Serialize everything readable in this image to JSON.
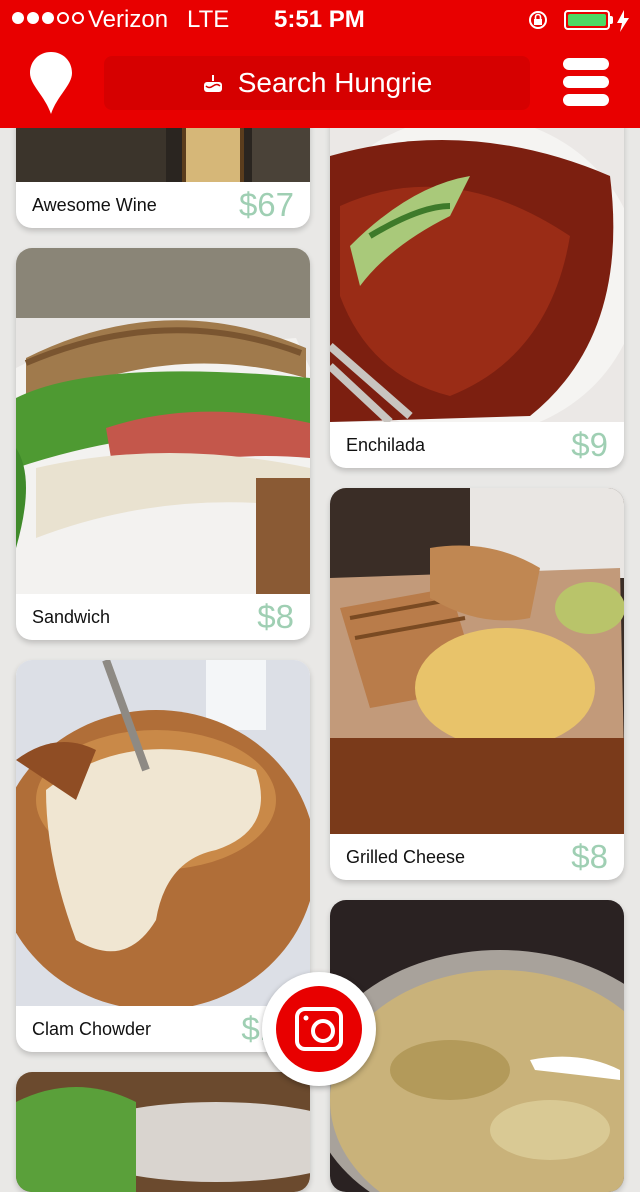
{
  "status_bar": {
    "carrier": "Verizon",
    "network": "LTE",
    "time": "5:51 PM",
    "signal_bars": 3,
    "signal_total": 5,
    "battery_level": 0.95
  },
  "nav": {
    "location_icon": "map-pin-icon",
    "search_icon": "cake-icon",
    "search_label": "Search Hungrie",
    "menu_icon": "hamburger-menu-icon",
    "bar_color": "#e80000"
  },
  "left_column": [
    {
      "name": "Awesome Wine",
      "price": "$67"
    },
    {
      "name": "Sandwich",
      "price": "$8"
    },
    {
      "name": "Clam Chowder",
      "price": "$11"
    },
    {
      "name": "",
      "price": ""
    }
  ],
  "right_column": [
    {
      "name": "Enchilada",
      "price": "$9"
    },
    {
      "name": "Grilled Cheese",
      "price": "$8"
    },
    {
      "name": "",
      "price": ""
    }
  ],
  "camera": {
    "icon": "camera-icon"
  },
  "colors": {
    "price": "#9fcfb3",
    "accent": "#e80000"
  }
}
